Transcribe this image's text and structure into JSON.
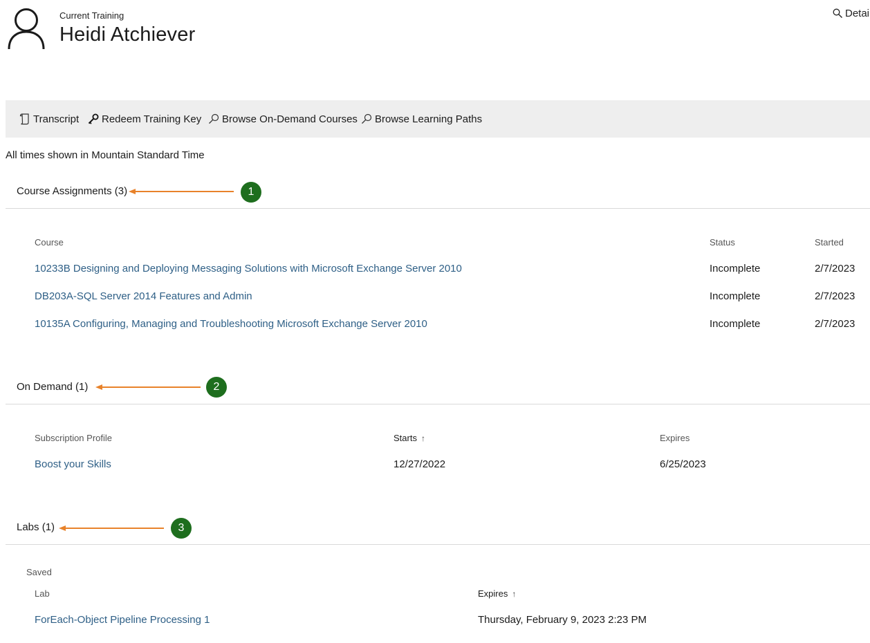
{
  "header": {
    "label": "Current Training",
    "name": "Heidi Atchiever",
    "details_link": "Detai"
  },
  "toolbar": {
    "transcript": "Transcript",
    "redeem": "Redeem Training Key",
    "browse_courses": "Browse On-Demand Courses",
    "browse_paths": "Browse Learning Paths"
  },
  "timezone_note": "All times shown in Mountain Standard Time",
  "course_assignments": {
    "title": "Course Assignments (3)",
    "badge": "1",
    "columns": {
      "course": "Course",
      "status": "Status",
      "started": "Started"
    },
    "rows": [
      {
        "course": "10233B Designing and Deploying Messaging Solutions with Microsoft Exchange Server 2010",
        "status": "Incomplete",
        "started": "2/7/2023"
      },
      {
        "course": "DB203A-SQL Server 2014 Features and Admin",
        "status": "Incomplete",
        "started": "2/7/2023"
      },
      {
        "course": "10135A Configuring, Managing and Troubleshooting Microsoft Exchange Server 2010",
        "status": "Incomplete",
        "started": "2/7/2023"
      }
    ]
  },
  "on_demand": {
    "title": "On Demand (1)",
    "badge": "2",
    "columns": {
      "profile": "Subscription Profile",
      "starts": "Starts",
      "expires": "Expires"
    },
    "rows": [
      {
        "profile": "Boost your Skills",
        "starts": "12/27/2022",
        "expires": "6/25/2023"
      }
    ]
  },
  "labs": {
    "title": "Labs (1)",
    "badge": "3",
    "group_label": "Saved",
    "columns": {
      "lab": "Lab",
      "expires": "Expires"
    },
    "rows": [
      {
        "lab": "ForEach-Object Pipeline Processing 1",
        "expires": "Thursday, February 9, 2023 2:23 PM"
      }
    ]
  },
  "colors": {
    "link": "#2e5f86",
    "toolbar_bg": "#eeeeee",
    "annotation_arrow": "#e8822a",
    "badge_bg": "#1e6e1e"
  }
}
